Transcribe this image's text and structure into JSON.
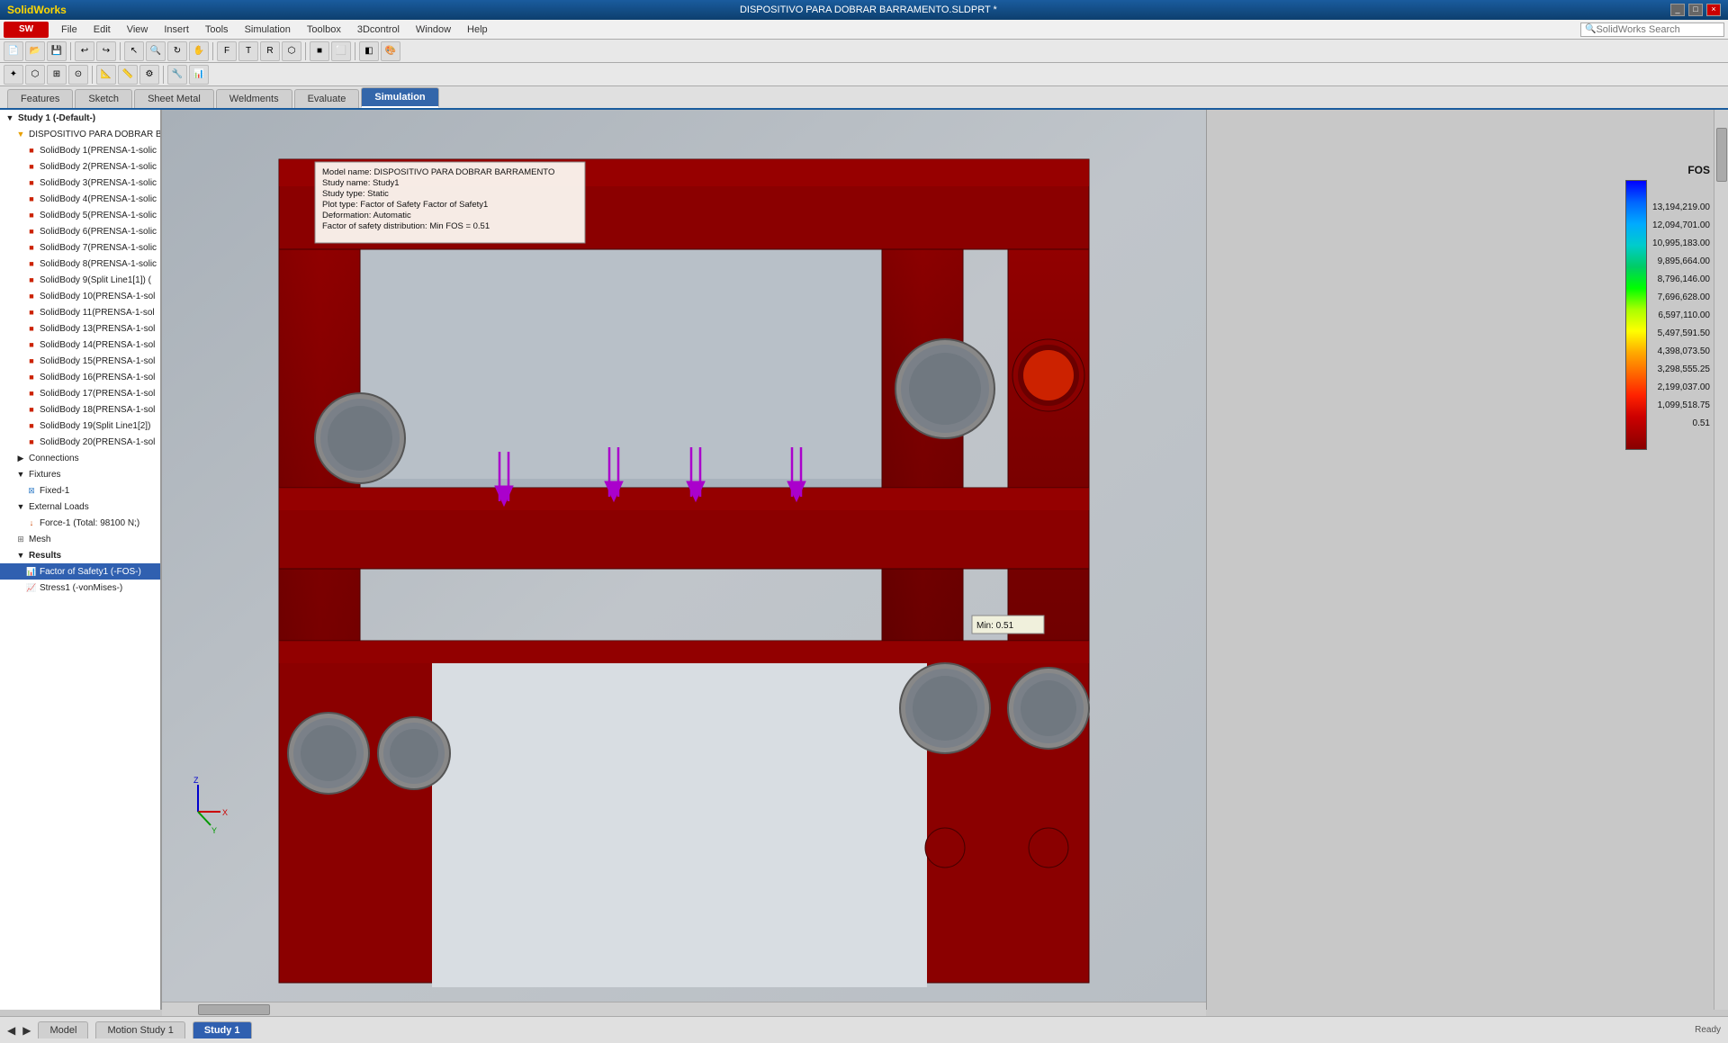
{
  "titlebar": {
    "title": "DISPOSITIVO PARA DOBRAR BARRAMENTO.SLDPRT *",
    "search_placeholder": "SolidWorks Search",
    "controls": [
      "_",
      "□",
      "×"
    ]
  },
  "menubar": {
    "logo": "SOLIDWORKS",
    "items": [
      "File",
      "Edit",
      "View",
      "Insert",
      "Tools",
      "Simulation",
      "Toolbox",
      "3Dcontrol",
      "Window",
      "Help"
    ]
  },
  "tabs": {
    "items": [
      "Features",
      "Sketch",
      "Sheet Metal",
      "Weldments",
      "Evaluate",
      "Simulation"
    ],
    "active": "Simulation"
  },
  "tree": {
    "root": "Study 1 (-Default-)",
    "main_part": "DISPOSITIVO PARA DOBRAR B",
    "bodies": [
      "SolidBody 1(PRENSA-1-solic",
      "SolidBody 2(PRENSA-1-solic",
      "SolidBody 3(PRENSA-1-solic",
      "SolidBody 4(PRENSA-1-solic",
      "SolidBody 5(PRENSA-1-solic",
      "SolidBody 6(PRENSA-1-solic",
      "SolidBody 7(PRENSA-1-solic",
      "SolidBody 8(PRENSA-1-solic",
      "SolidBody 9(Split Line1[1]) (",
      "SolidBody 10(PRENSA-1-sol",
      "SolidBody 11(PRENSA-1-sol",
      "SolidBody 13(PRENSA-1-sol",
      "SolidBody 14(PRENSA-1-sol",
      "SolidBody 15(PRENSA-1-sol",
      "SolidBody 16(PRENSA-1-sol",
      "SolidBody 17(PRENSA-1-sol",
      "SolidBody 18(PRENSA-1-sol",
      "SolidBody 19(Split Line1[2])",
      "SolidBody 20(PRENSA-1-sol"
    ],
    "connections": "Connections",
    "fixtures": {
      "label": "Fixtures",
      "items": [
        "Fixed-1"
      ]
    },
    "external_loads": {
      "label": "External Loads",
      "items": [
        "Force-1 (Total: 98100 N;)"
      ]
    },
    "mesh": "Mesh",
    "results": {
      "label": "Results",
      "items": [
        "Factor of Safety1 (-FOS-)",
        "Stress1 (-vonMises-)"
      ]
    }
  },
  "tooltip": {
    "study_name": "Study name: Study1",
    "study_type": "Study type: Static",
    "plot_type": "Plot type: Factor of Safety Factor of Safety1",
    "deformation": "Deformation: Automatic",
    "fos": "Factor of safety distribution: Min FOS = 0.51"
  },
  "scale": {
    "title": "FOS",
    "values": [
      "13,194,219.00",
      "12,094,701.00",
      "10,995,183.00",
      "9,895,664.00",
      "8,796,146.00",
      "7,696,628.00",
      "6,597,110.00",
      "5,497,591.50",
      "4,398,073.50",
      "3,298,555.25",
      "2,199,037.00",
      "1,099,518.75",
      "0.51"
    ]
  },
  "min_label": "Min: 0.51",
  "bottom_tabs": {
    "items": [
      "Model",
      "Motion Study 1",
      "Study 1"
    ],
    "active": "Study 1"
  },
  "force_arrows": {
    "label": "Force arrows (purple downward)",
    "positions": [
      1,
      2,
      3,
      4
    ]
  }
}
